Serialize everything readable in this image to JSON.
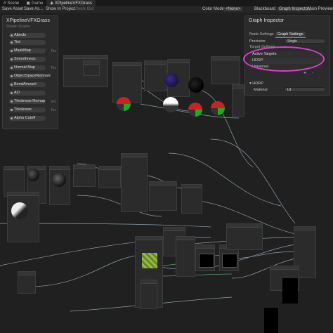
{
  "window_tabs": [
    {
      "label": "Scene",
      "icon": "scene-icon"
    },
    {
      "label": "Game",
      "icon": "game-icon"
    },
    {
      "label": "XPipelineVFXGrass",
      "icon": "shader-graph-icon"
    }
  ],
  "toolbar": {
    "save_asset": "Save Asset",
    "save_as": "Save As...",
    "show_in_project": "Show In Project",
    "check_out": "Check Out",
    "color_mode_label": "Color Mode",
    "color_mode_value": "<None>",
    "blackboard": "Blackboard",
    "graph_inspector": "Graph Inspector",
    "main_preview": "Main Preview"
  },
  "blackboard": {
    "title": "XPipelineVFXGrass",
    "subtitle": "Shader Graphs",
    "properties": [
      {
        "label": "Albedo"
      },
      {
        "label": "Tint"
      },
      {
        "label": "MaskMap",
        "type": "Tex"
      },
      {
        "label": "Smoothness"
      },
      {
        "label": "Normal Map",
        "type": "Tex"
      },
      {
        "label": "ObjectSpaceNormals"
      },
      {
        "label": "BendAmount"
      },
      {
        "label": "AO"
      },
      {
        "label": "Thickness Remap",
        "type": "Vec"
      },
      {
        "label": "Thickness",
        "type": "Tex"
      },
      {
        "label": "Alpha Cutoff"
      }
    ]
  },
  "graph_inspector": {
    "title": "Graph Inspector",
    "tabs": [
      "Node Settings",
      "Graph Settings"
    ],
    "active_tab": "Graph Settings",
    "precision_label": "Precision",
    "precision_value": "Single",
    "target_settings": "Target Settings",
    "active_targets_label": "Active Targets",
    "targets": [
      "HDRP",
      "Universal"
    ],
    "add_button": "+",
    "remove_button": "-",
    "hdrp_section": "HDRP",
    "material_label": "Material",
    "material_value": "Lit"
  },
  "colors": {
    "highlight_circle": "#e23cd6",
    "wire": "#8aa0a8",
    "wire_green": "#5aa06a"
  }
}
